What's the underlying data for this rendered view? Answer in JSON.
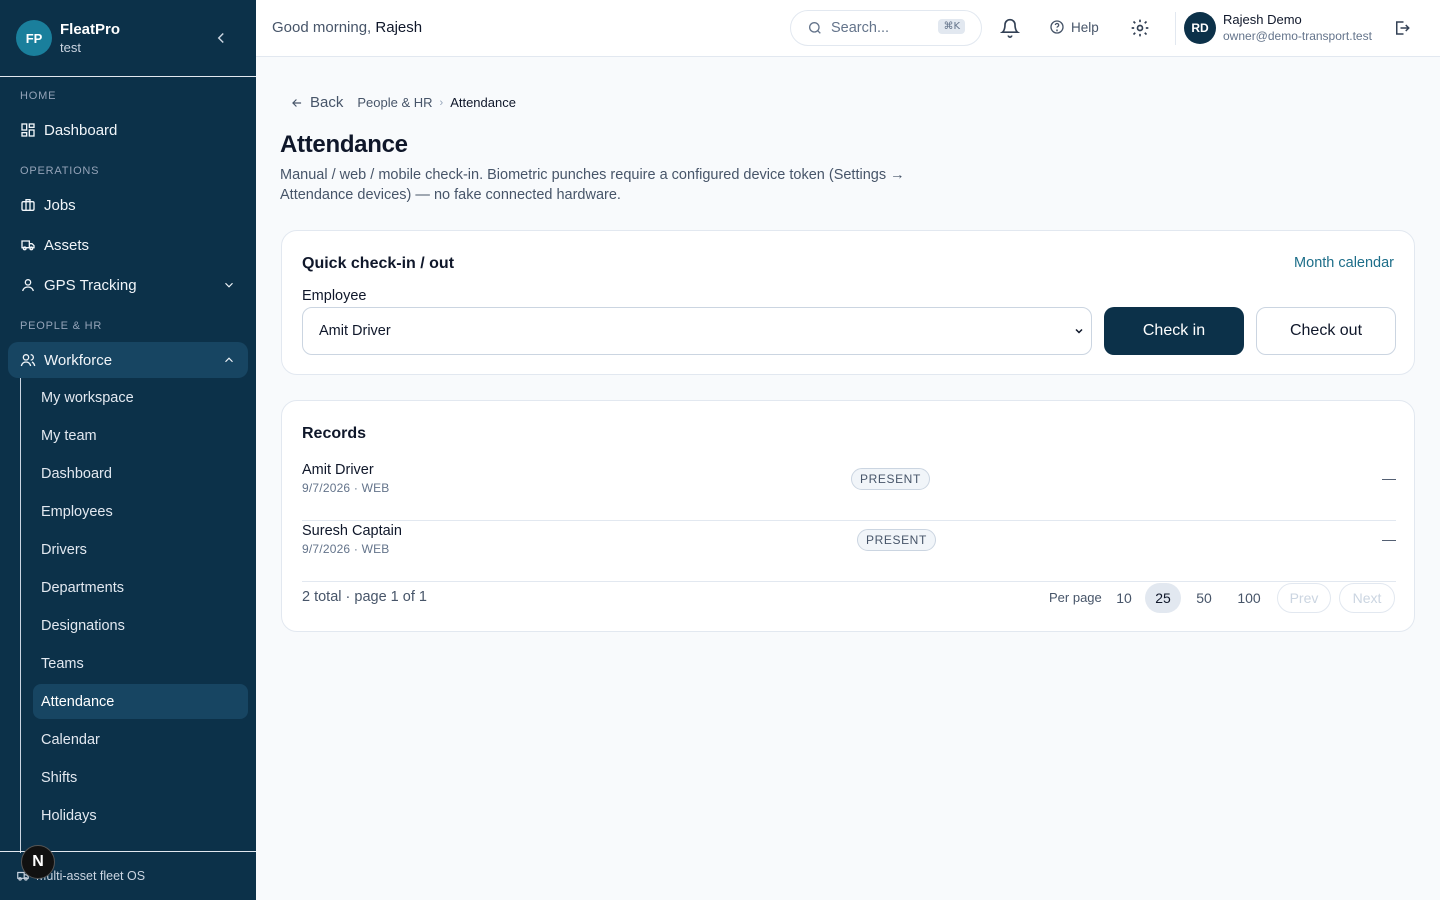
{
  "brand": {
    "initials": "FP",
    "name": "FleatPro",
    "sub": "test"
  },
  "sidebar": {
    "sections": [
      "HOME",
      "OPERATIONS",
      "PEOPLE & HR"
    ],
    "items": [
      {
        "label": "Dashboard"
      },
      {
        "label": "Jobs"
      },
      {
        "label": "Assets"
      },
      {
        "label": "GPS Tracking"
      },
      {
        "label": "Workforce"
      }
    ],
    "subitems": [
      {
        "label": "My workspace"
      },
      {
        "label": "My team"
      },
      {
        "label": "Dashboard"
      },
      {
        "label": "Employees"
      },
      {
        "label": "Drivers"
      },
      {
        "label": "Departments"
      },
      {
        "label": "Designations"
      },
      {
        "label": "Teams"
      },
      {
        "label": "Attendance"
      },
      {
        "label": "Calendar"
      },
      {
        "label": "Shifts"
      },
      {
        "label": "Holidays"
      }
    ],
    "footer": "Multi-asset fleet OS",
    "n_badge": "N"
  },
  "topbar": {
    "greeting_prefix": "Good morning,",
    "greeting_name": "Rajesh",
    "search_placeholder": "Search...",
    "search_kbd": "⌘K",
    "help_label": "Help",
    "user_initials": "RD",
    "user_name": "Rajesh Demo",
    "user_email": "owner@demo-transport.test"
  },
  "breadcrumb": {
    "back": "Back",
    "parent": "People & HR",
    "current": "Attendance"
  },
  "page": {
    "title": "Attendance",
    "description": "Manual / web / mobile check-in. Biometric punches require a configured device token (Settings → Attendance devices) — no fake connected hardware."
  },
  "quick_check": {
    "title": "Quick check-in / out",
    "calendar_link": "Month calendar",
    "employee_label": "Employee",
    "employee_value": "Amit Driver",
    "check_in_label": "Check in",
    "check_out_label": "Check out"
  },
  "records": {
    "title": "Records",
    "rows": [
      {
        "name": "Amit Driver",
        "meta": "9/7/2026 · WEB",
        "status": "PRESENT",
        "end": "—"
      },
      {
        "name": "Suresh Captain",
        "meta": "9/7/2026 · WEB",
        "status": "PRESENT",
        "end": "—"
      }
    ],
    "total_text": "2 total · page 1 of 1",
    "per_page_label": "Per page",
    "per_page_options": [
      "10",
      "25",
      "50",
      "100"
    ],
    "per_page_selected": "25",
    "prev_label": "Prev",
    "next_label": "Next"
  }
}
